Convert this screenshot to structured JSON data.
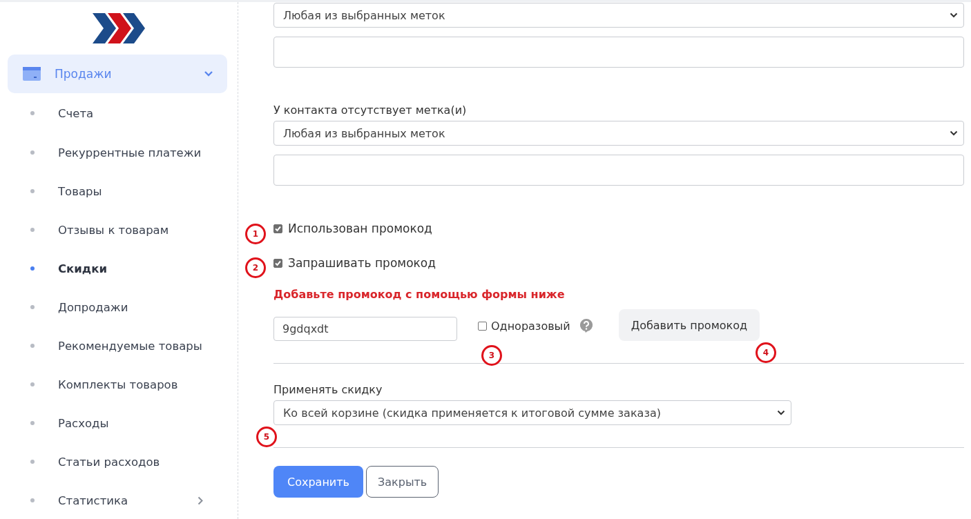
{
  "sidebar": {
    "section": {
      "label": "Продажи",
      "expanded": true
    },
    "items": [
      {
        "label": "Счета",
        "selected": false
      },
      {
        "label": "Рекуррентные платежи",
        "selected": false
      },
      {
        "label": "Товары",
        "selected": false
      },
      {
        "label": "Отзывы к товарам",
        "selected": false
      },
      {
        "label": "Скидки",
        "selected": true
      },
      {
        "label": "Допродажи",
        "selected": false
      },
      {
        "label": "Рекомендуемые товары",
        "selected": false
      },
      {
        "label": "Комплекты товаров",
        "selected": false
      },
      {
        "label": "Расходы",
        "selected": false
      },
      {
        "label": "Статьи расходов",
        "selected": false
      },
      {
        "label": "Статистика",
        "selected": false,
        "has_children": true
      }
    ]
  },
  "form": {
    "rows": [
      {
        "kind": "select",
        "value": "Любая из выбранных меток"
      },
      {
        "kind": "tags"
      },
      {
        "kind": "label",
        "text": "У контакта отсутствует метка(и)"
      },
      {
        "kind": "select",
        "value": "Любая из выбранных меток"
      },
      {
        "kind": "tags"
      },
      {
        "kind": "checkbox",
        "label": "Использован промокод",
        "checked": true
      },
      {
        "kind": "checkbox",
        "label": "Запрашивать промокод",
        "checked": true
      },
      {
        "kind": "notice",
        "text": "Добавьте промокод с помощью формы ниже"
      },
      {
        "kind": "promo",
        "code": "9gdqxdt",
        "one_time": {
          "label": "Одноразовый",
          "checked": false
        },
        "button": "Добавить промокод"
      },
      {
        "kind": "divider"
      },
      {
        "kind": "label",
        "text": "Применять скидку"
      },
      {
        "kind": "scope-select",
        "value": "Ко всей корзине (скидка применяется к итоговой сумме заказа)"
      },
      {
        "kind": "divider"
      },
      {
        "kind": "actions",
        "primary": "Сохранить",
        "secondary": "Закрыть"
      }
    ]
  },
  "annotations": [
    "1",
    "2",
    "3",
    "4",
    "5"
  ]
}
